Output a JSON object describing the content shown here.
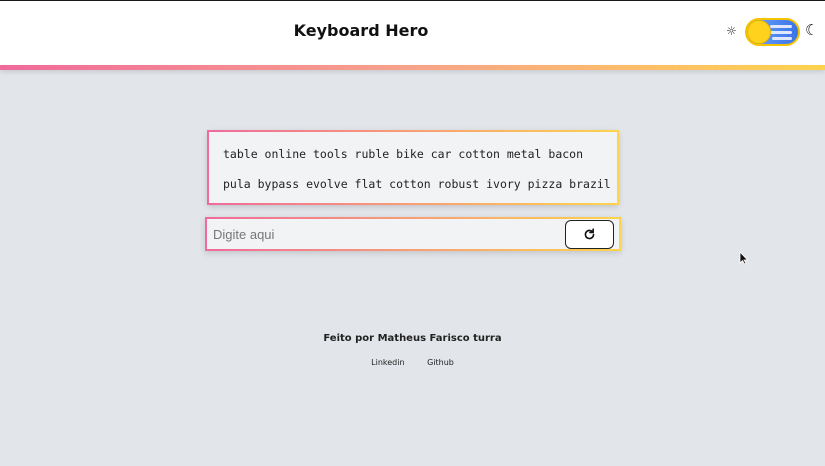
{
  "header": {
    "title": "Keyboard Hero",
    "sun_icon": "sun-icon",
    "moon_icon": "moon-icon",
    "toggle_state": "light"
  },
  "words": {
    "lines": [
      "table online tools ruble bike car cotton metal bacon",
      "pula bypass evolve flat cotton robust ivory pizza brazil"
    ]
  },
  "input": {
    "placeholder": "Digite aqui",
    "value": ""
  },
  "reload_button": {
    "icon": "reload-icon"
  },
  "footer": {
    "credit": "Feito por Matheus Farisco turra",
    "links": [
      "Linkedin",
      "Github"
    ]
  },
  "colors": {
    "background": "#e2e5ea",
    "gradient_start": "#f06a9b",
    "gradient_end": "#ffd34d",
    "toggle_blue": "#3b72e6",
    "toggle_sun": "#ffd21e"
  }
}
